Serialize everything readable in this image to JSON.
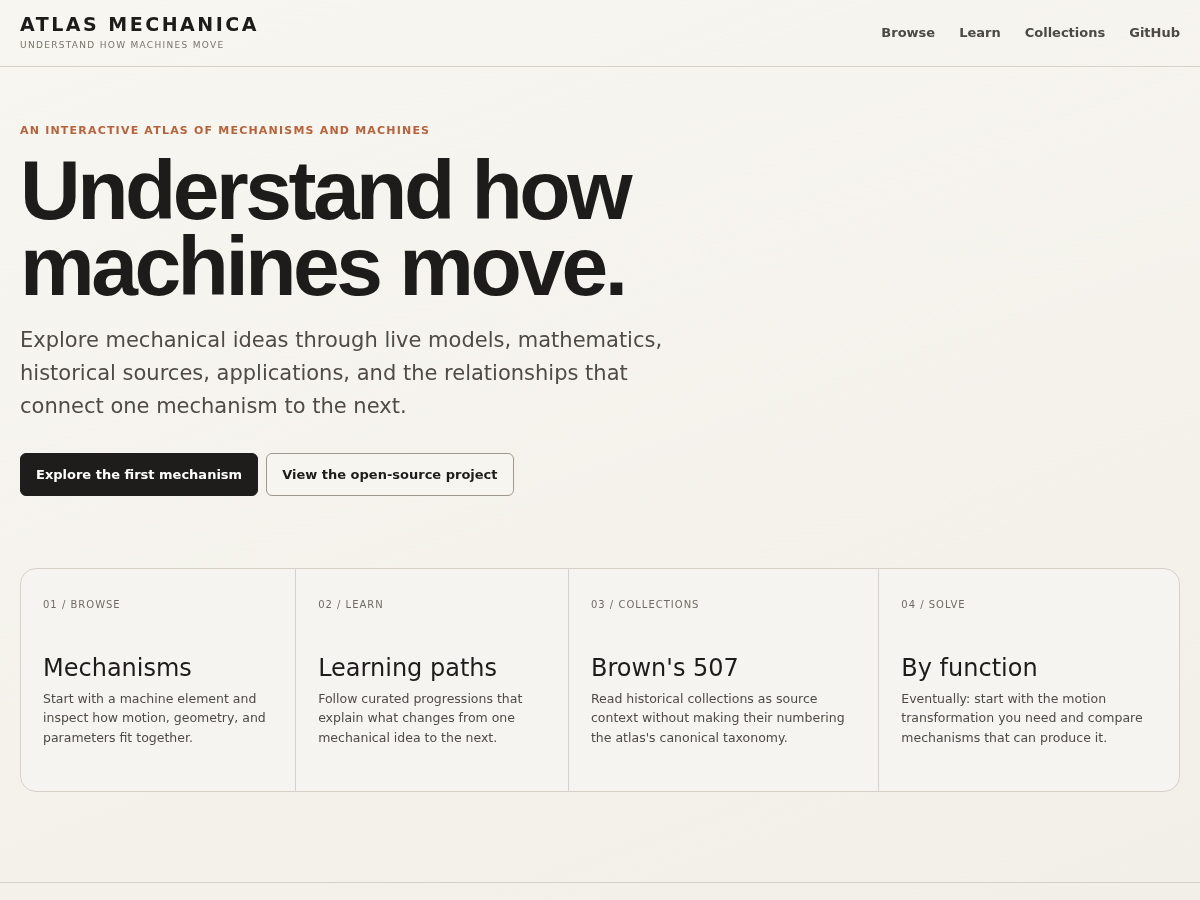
{
  "header": {
    "brand": "ATLAS MECHANICA",
    "tagline": "UNDERSTAND HOW MACHINES MOVE",
    "nav": [
      "Browse",
      "Learn",
      "Collections",
      "GitHub"
    ]
  },
  "hero": {
    "eyebrow": "AN INTERACTIVE ATLAS OF MECHANISMS AND MACHINES",
    "title": "Understand how machines move.",
    "lead": "Explore mechanical ideas through live models, mathematics, historical sources, applications, and the relationships that connect one mechanism to the next.",
    "buttons": [
      {
        "label": "Explore the first mechanism",
        "kind": "primary"
      },
      {
        "label": "View the open-source project",
        "kind": "secondary"
      }
    ]
  },
  "cards": [
    {
      "eyebrow": "01 / BROWSE",
      "title": "Mechanisms",
      "text": "Start with a machine element and inspect how motion, geometry, and parameters fit together."
    },
    {
      "eyebrow": "02 / LEARN",
      "title": "Learning paths",
      "text": "Follow curated progressions that explain what changes from one mechanical idea to the next."
    },
    {
      "eyebrow": "03 / COLLECTIONS",
      "title": "Brown's 507",
      "text": "Read historical collections as source context without making their numbering the atlas's canonical taxonomy."
    },
    {
      "eyebrow": "04 / SOLVE",
      "title": "By function",
      "text": "Eventually: start with the motion transformation you need and compare mechanisms that can produce it."
    }
  ]
}
